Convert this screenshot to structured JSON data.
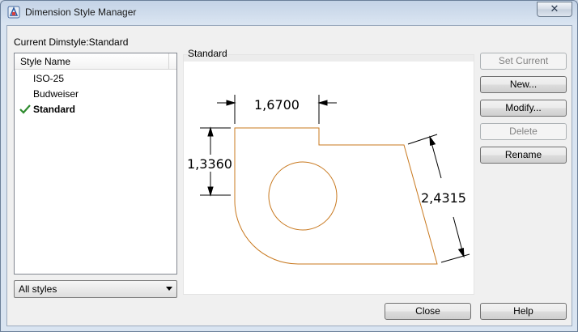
{
  "window": {
    "title": "Dimension Style Manager",
    "close_glyph": "✕"
  },
  "current_dimstyle_label": "Current Dimstyle:Standard",
  "styles_list": {
    "header": "Style Name",
    "items": [
      {
        "label": "ISO-25",
        "current": false
      },
      {
        "label": "Budweiser",
        "current": false
      },
      {
        "label": "Standard",
        "current": true
      }
    ]
  },
  "filter_dropdown": {
    "selected": "All styles"
  },
  "preview": {
    "title": "Standard",
    "dimensions": {
      "horizontal": "1,6700",
      "vertical": "1,3360",
      "aligned": "2,4315"
    },
    "colors": {
      "geometry": "#c8781e",
      "dimension": "#000000"
    }
  },
  "buttons": {
    "set_current": "Set Current",
    "new": "New...",
    "modify": "Modify...",
    "delete": "Delete",
    "rename": "Rename",
    "close": "Close",
    "help": "Help"
  },
  "icons": {
    "app": "autocad-app-icon",
    "current_marker": "checkmark-icon",
    "dropdown": "chevron-down-icon"
  }
}
